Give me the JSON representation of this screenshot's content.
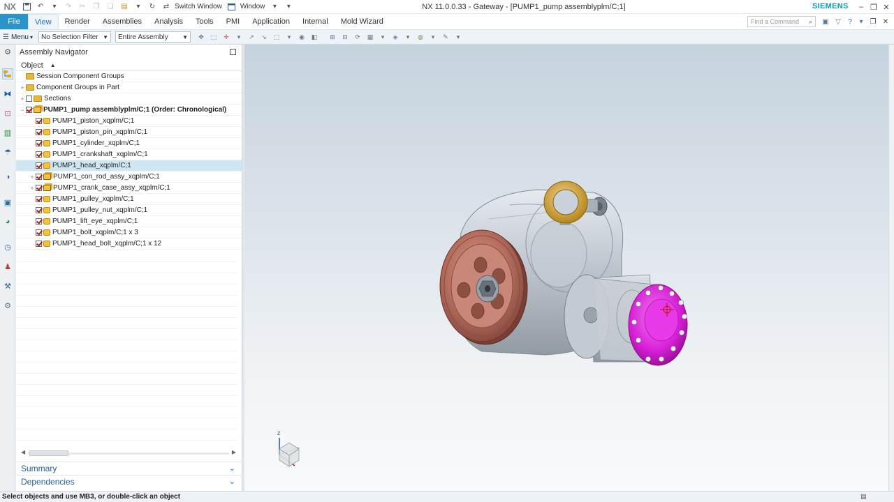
{
  "titlebar": {
    "logo": "NX",
    "switch_window": "Switch Window",
    "window_menu": "Window",
    "title": "NX 11.0.0.33 - Gateway - [PUMP1_pump assemblyplm/C;1]",
    "brand": "SIEMENS"
  },
  "ribbon": {
    "file": "File",
    "tabs": [
      "View",
      "Render",
      "Assemblies",
      "Analysis",
      "Tools",
      "PMI",
      "Application",
      "Internal",
      "Mold Wizard"
    ],
    "active_tab": "View",
    "find_placeholder": "Find a Command"
  },
  "toolbar": {
    "menu": "Menu",
    "selection_filter": "No Selection Filter",
    "scope": "Entire Assembly"
  },
  "navigator": {
    "title": "Assembly Navigator",
    "column": "Object",
    "rows": [
      {
        "label": "Session Component Groups"
      },
      {
        "label": "Component Groups in Part"
      },
      {
        "label": "Sections"
      },
      {
        "label": "PUMP1_pump assemblyplm/C;1 (Order: Chronological)"
      },
      {
        "label": "PUMP1_piston_xqplm/C;1"
      },
      {
        "label": "PUMP1_piston_pin_xqplm/C;1"
      },
      {
        "label": "PUMP1_cylinder_xqplm/C;1"
      },
      {
        "label": "PUMP1_crankshaft_xqplm/C;1"
      },
      {
        "label": "PUMP1_head_xqplm/C;1",
        "selected": true
      },
      {
        "label": "PUMP1_con_rod_assy_xqplm/C;1"
      },
      {
        "label": "PUMP1_crank_case_assy_xqplm/C;1"
      },
      {
        "label": "PUMP1_pulley_xqplm/C;1"
      },
      {
        "label": "PUMP1_pulley_nut_xqplm/C;1"
      },
      {
        "label": "PUMP1_lift_eye_xqplm/C;1"
      },
      {
        "label": "PUMP1_bolt_xqplm/C;1 x 3"
      },
      {
        "label": "PUMP1_head_bolt_xqplm/C;1 x 12"
      }
    ],
    "panels": [
      "Summary",
      "Dependencies"
    ]
  },
  "triad": {
    "axis_z": "Z"
  },
  "status": {
    "message": "Select objects and use MB3, or double-click an object"
  }
}
